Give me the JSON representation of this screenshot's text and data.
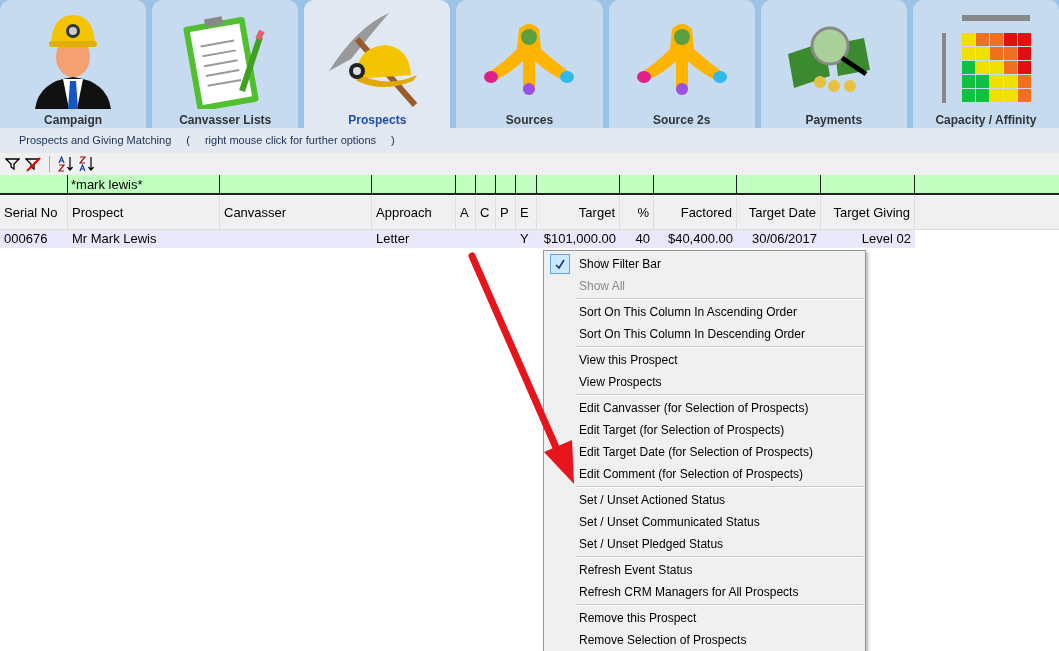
{
  "tabs": [
    {
      "label": "Campaign",
      "selected": false
    },
    {
      "label": "Canvasser Lists",
      "selected": false
    },
    {
      "label": "Prospects",
      "selected": true
    },
    {
      "label": "Sources",
      "selected": false
    },
    {
      "label": "Source 2s",
      "selected": false
    },
    {
      "label": "Payments",
      "selected": false
    },
    {
      "label": "Capacity / Affinity",
      "selected": false
    }
  ],
  "subtitle": {
    "title": "Prospects and Giving Matching",
    "open_paren": "(",
    "hint": "right mouse click for further options",
    "close_paren": ")"
  },
  "table": {
    "prospect_filter": "*mark lewis*",
    "columns": [
      "Serial No",
      "Prospect",
      "Canvasser",
      "Approach",
      "A",
      "C",
      "P",
      "E",
      "Target",
      "%",
      "Factored",
      "Target Date",
      "Target Giving"
    ],
    "rows": [
      {
        "selected": true,
        "cells": [
          "000676",
          "Mr Mark Lewis",
          null,
          "Letter",
          null,
          null,
          null,
          "Y",
          "$101,000.00",
          "40",
          "$40,400.00",
          "30/06/2017",
          "Level 02"
        ]
      }
    ]
  },
  "context_menu": [
    [
      {
        "label": "Show Filter Bar",
        "checked": true,
        "disabled": false
      },
      {
        "label": "Show All",
        "checked": false,
        "disabled": true
      }
    ],
    [
      {
        "label": "Sort On This Column In Ascending Order",
        "checked": false,
        "disabled": false
      },
      {
        "label": "Sort On This Column In Descending Order",
        "checked": false,
        "disabled": false
      }
    ],
    [
      {
        "label": "View this Prospect",
        "checked": false,
        "disabled": false
      },
      {
        "label": "View Prospects",
        "checked": false,
        "disabled": false
      }
    ],
    [
      {
        "label": "Edit Canvasser (for Selection of Prospects)",
        "checked": false,
        "disabled": false
      },
      {
        "label": "Edit Target (for Selection of Prospects)",
        "checked": false,
        "disabled": false
      },
      {
        "label": "Edit Target Date (for Selection of Prospects)",
        "checked": false,
        "disabled": false
      },
      {
        "label": "Edit Comment (for Selection of Prospects)",
        "checked": false,
        "disabled": false
      }
    ],
    [
      {
        "label": "Set / Unset Actioned Status",
        "checked": false,
        "disabled": false
      },
      {
        "label": "Set / Unset Communicated Status",
        "checked": false,
        "disabled": false
      },
      {
        "label": "Set / Unset Pledged Status",
        "checked": false,
        "disabled": false
      }
    ],
    [
      {
        "label": "Refresh Event Status",
        "checked": false,
        "disabled": false
      },
      {
        "label": "Refresh CRM Managers for All Prospects",
        "checked": false,
        "disabled": false
      }
    ],
    [
      {
        "label": "Remove this Prospect",
        "checked": false,
        "disabled": false
      },
      {
        "label": "Remove Selection of Prospects",
        "checked": false,
        "disabled": false
      }
    ]
  ]
}
